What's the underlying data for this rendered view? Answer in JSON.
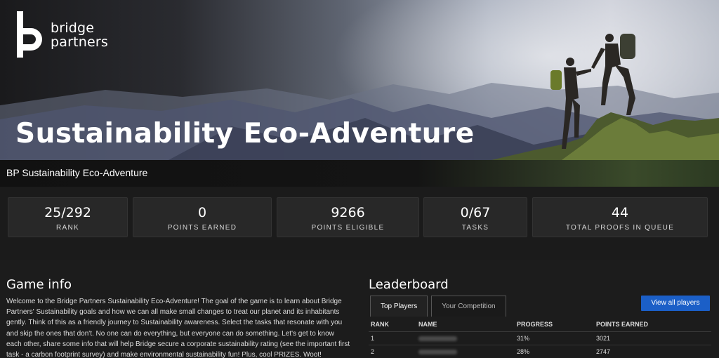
{
  "brand": {
    "line1": "bridge",
    "line2": "partners"
  },
  "hero": {
    "title": "Sustainability Eco-Adventure"
  },
  "subbar": {
    "title": "BP Sustainability Eco-Adventure"
  },
  "stats": [
    {
      "value": "25/292",
      "label": "RANK"
    },
    {
      "value": "0",
      "label": "POINTS EARNED"
    },
    {
      "value": "9266",
      "label": "POINTS ELIGIBLE"
    },
    {
      "value": "0/67",
      "label": "TASKS"
    },
    {
      "value": "44",
      "label": "TOTAL PROOFS IN QUEUE"
    }
  ],
  "game_info": {
    "heading": "Game info",
    "body": "Welcome to the Bridge Partners Sustainability Eco-Adventure! The goal of the game is to learn about Bridge Partners' Sustainability goals and how we can all make small changes to treat our planet and its inhabitants gently. Think of this as a friendly journey to Sustainability awareness. Select the tasks that resonate with you and skip the ones that don't. No one can do everything, but everyone can do something. Let's get to know each other, share some info that will help Bridge secure a corporate sustainability rating (see the important first task - a carbon footprint survey) and make environmental sustainability fun! Plus, cool PRIZES. Woot!"
  },
  "leaderboard": {
    "heading": "Leaderboard",
    "tabs": [
      "Top Players",
      "Your Competition"
    ],
    "view_all": "View all players",
    "columns": [
      "RANK",
      "NAME",
      "PROGRESS",
      "POINTS EARNED"
    ],
    "rows": [
      {
        "rank": "1",
        "progress": "31%",
        "points": "3021"
      },
      {
        "rank": "2",
        "progress": "28%",
        "points": "2747"
      }
    ]
  },
  "icons": {
    "logo": "bridge-partners-logo-icon"
  },
  "colors": {
    "accent_button": "#1b5fc7",
    "page_bg": "#1c1c1c",
    "card_bg": "#282828"
  }
}
